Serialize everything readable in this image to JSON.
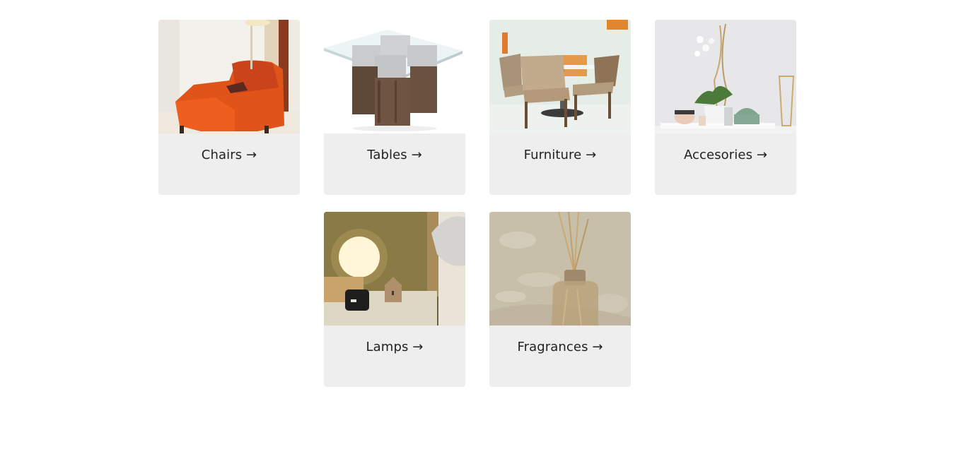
{
  "categories": [
    {
      "label": "Chairs →",
      "image": "orange-armchair-photo"
    },
    {
      "label": "Tables →",
      "image": "glass-top-wooden-table-photo"
    },
    {
      "label": "Furniture →",
      "image": "dining-set-photo"
    },
    {
      "label": "Accesories →",
      "image": "orchid-and-decor-photo"
    },
    {
      "label": "Lamps →",
      "image": "globe-lamp-photo"
    },
    {
      "label": "Fragrances →",
      "image": "reed-diffuser-photo"
    }
  ],
  "colors": {
    "card_background": "#eeeeee",
    "label_text": "#222222",
    "page_background": "#ffffff"
  }
}
